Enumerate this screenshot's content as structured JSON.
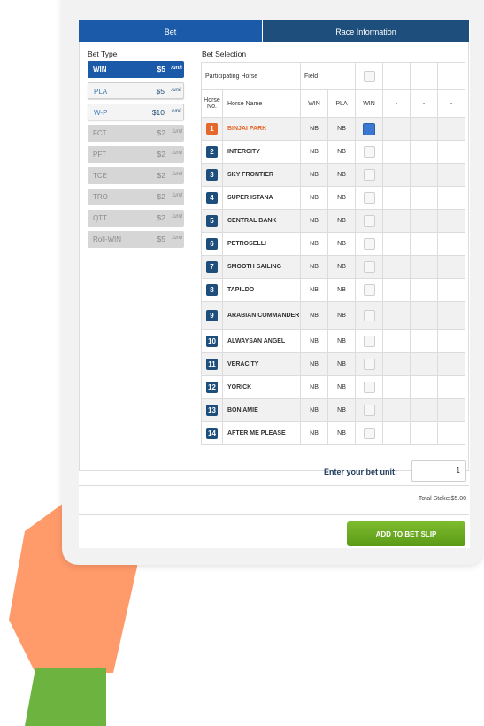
{
  "tabs": {
    "bet": "Bet",
    "race_info": "Race Information"
  },
  "bet_type": {
    "title": "Bet Type",
    "items": [
      {
        "name": "WIN",
        "price": "$5",
        "unit": "/unit",
        "state": "selected"
      },
      {
        "name": "PLA",
        "price": "$5",
        "unit": "/unit",
        "state": "active"
      },
      {
        "name": "W-P",
        "price": "$10",
        "unit": "/unit",
        "state": "active"
      },
      {
        "name": "FCT",
        "price": "$2",
        "unit": "/unit",
        "state": "disabled"
      },
      {
        "name": "PFT",
        "price": "$2",
        "unit": "/unit",
        "state": "disabled"
      },
      {
        "name": "TCE",
        "price": "$2",
        "unit": "/unit",
        "state": "disabled"
      },
      {
        "name": "TRO",
        "price": "$2",
        "unit": "/unit",
        "state": "disabled"
      },
      {
        "name": "QTT",
        "price": "$2",
        "unit": "/unit",
        "state": "disabled"
      },
      {
        "name": "Roll-WIN",
        "price": "$5",
        "unit": "/unit",
        "state": "disabled"
      }
    ]
  },
  "bet_selection": {
    "title": "Bet Selection",
    "participating_horse": "Participating Horse",
    "field": "Field",
    "col_horse_no": "Horse No.",
    "col_horse_name": "Horse Name",
    "col_win": "WIN",
    "col_pla": "PLA",
    "col_win_select": "WIN",
    "dash": "-",
    "horses": [
      {
        "no": "1",
        "name": "BINJAI PARK",
        "win": "NB",
        "pla": "NB",
        "checked": true
      },
      {
        "no": "2",
        "name": "INTERCITY",
        "win": "NB",
        "pla": "NB",
        "checked": false
      },
      {
        "no": "3",
        "name": "SKY FRONTIER",
        "win": "NB",
        "pla": "NB",
        "checked": false
      },
      {
        "no": "4",
        "name": "SUPER ISTANA",
        "win": "NB",
        "pla": "NB",
        "checked": false
      },
      {
        "no": "5",
        "name": "CENTRAL BANK",
        "win": "NB",
        "pla": "NB",
        "checked": false
      },
      {
        "no": "6",
        "name": "PETROSELLI",
        "win": "NB",
        "pla": "NB",
        "checked": false
      },
      {
        "no": "7",
        "name": "SMOOTH SAILING",
        "win": "NB",
        "pla": "NB",
        "checked": false
      },
      {
        "no": "8",
        "name": "TAPILDO",
        "win": "NB",
        "pla": "NB",
        "checked": false
      },
      {
        "no": "9",
        "name": "ARABIAN COMMANDER",
        "win": "NB",
        "pla": "NB",
        "checked": false
      },
      {
        "no": "10",
        "name": "ALWAYSAN ANGEL",
        "win": "NB",
        "pla": "NB",
        "checked": false
      },
      {
        "no": "11",
        "name": "VERACITY",
        "win": "NB",
        "pla": "NB",
        "checked": false
      },
      {
        "no": "12",
        "name": "YORICK",
        "win": "NB",
        "pla": "NB",
        "checked": false
      },
      {
        "no": "13",
        "name": "BON AMIE",
        "win": "NB",
        "pla": "NB",
        "checked": false
      },
      {
        "no": "14",
        "name": "AFTER ME PLEASE",
        "win": "NB",
        "pla": "NB",
        "checked": false
      }
    ]
  },
  "footer": {
    "bet_unit_label": "Enter your bet unit:",
    "bet_unit_value": "1",
    "total_stake": "Total Stake:$5.00",
    "add_button": "ADD TO BET SLIP"
  },
  "colors": {
    "tab_active": "#1b5aa8",
    "tab_inactive": "#1d4e7c",
    "accent_orange": "#e4672b",
    "button_green": "#6aab22",
    "skin": "#ff9a6a",
    "sleeve": "#6cb33f"
  }
}
